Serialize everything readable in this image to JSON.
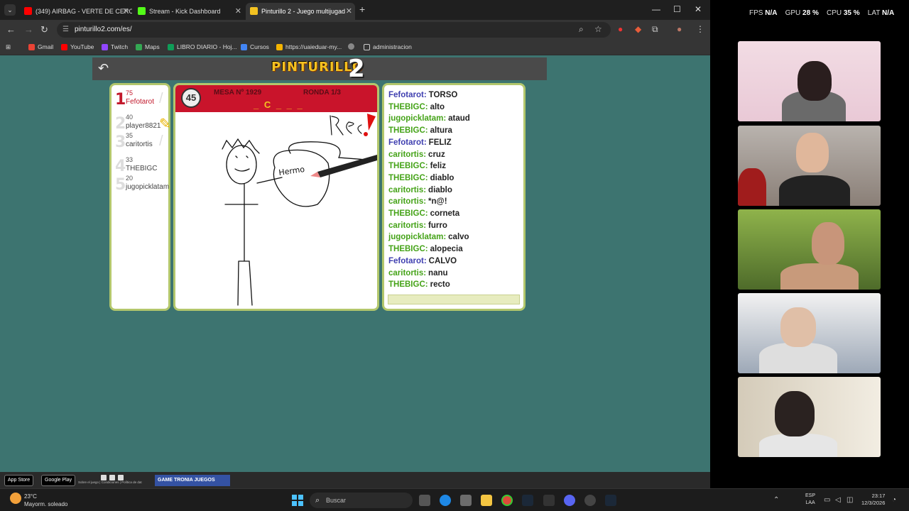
{
  "browser": {
    "tabs": [
      {
        "title": "(349) AIRBAG - VERTE DE CERC",
        "color": "#ff0000"
      },
      {
        "title": "Stream - Kick Dashboard",
        "color": "#53fc18"
      },
      {
        "title": "Pinturillo 2 - Juego multijugad",
        "color": "#f3c221"
      }
    ],
    "url": "pinturillo2.com/es/",
    "bookmarks": [
      {
        "label": "Gmail",
        "color": "#ea4335"
      },
      {
        "label": "YouTube",
        "color": "#ff0000"
      },
      {
        "label": "Twitch",
        "color": "#9146ff"
      },
      {
        "label": "Maps",
        "color": "#34a853"
      },
      {
        "label": "LIBRO DIARIO - Hoj...",
        "color": "#0f9d58"
      },
      {
        "label": "Cursos",
        "color": "#4285f4"
      },
      {
        "label": "https://uaieduar-my...",
        "color": "#f4b400"
      },
      {
        "label": "",
        "color": "#888888"
      },
      {
        "label": "administracion",
        "color": "#888888"
      }
    ]
  },
  "game": {
    "logo": "PINTURILLO",
    "logo_number": "2",
    "timer": "45",
    "mesa": "MESA Nº 1929",
    "ronda": "RONDA 1/3",
    "word": "_ C _ _ _",
    "players": [
      {
        "rank": "1",
        "points": "75",
        "name": "Fefotarot"
      },
      {
        "rank": "2",
        "points": "40",
        "name": "player8821"
      },
      {
        "rank": "3",
        "points": "35",
        "name": "caritortis"
      },
      {
        "rank": "4",
        "points": "33",
        "name": "THEBIGC"
      },
      {
        "rank": "5",
        "points": "20",
        "name": "jugopicklatam"
      }
    ],
    "drawing_text": {
      "rec": "Rec",
      "hermo": "Hermo"
    },
    "chat": [
      {
        "user": "Fefotarot:",
        "msg": "TORSO",
        "color": "#3f3fb0"
      },
      {
        "user": "THEBIGC:",
        "msg": "alto",
        "color": "#45a318"
      },
      {
        "user": "jugopicklatam:",
        "msg": "ataud",
        "color": "#45a318"
      },
      {
        "user": "THEBIGC:",
        "msg": "altura",
        "color": "#45a318"
      },
      {
        "user": "Fefotarot:",
        "msg": "FELIZ",
        "color": "#3f3fb0"
      },
      {
        "user": "caritortis:",
        "msg": "cruz",
        "color": "#45a318"
      },
      {
        "user": "THEBIGC:",
        "msg": "feliz",
        "color": "#45a318"
      },
      {
        "user": "THEBIGC:",
        "msg": "diablo",
        "color": "#45a318"
      },
      {
        "user": "caritortis:",
        "msg": "diablo",
        "color": "#45a318"
      },
      {
        "user": "caritortis:",
        "msg": "*n@!",
        "color": "#45a318"
      },
      {
        "user": "THEBIGC:",
        "msg": "corneta",
        "color": "#45a318"
      },
      {
        "user": "caritortis:",
        "msg": "furro",
        "color": "#45a318"
      },
      {
        "user": "jugopicklatam:",
        "msg": "calvo",
        "color": "#45a318"
      },
      {
        "user": "THEBIGC:",
        "msg": "alopecia",
        "color": "#45a318"
      },
      {
        "user": "Fefotarot:",
        "msg": "CALVO",
        "color": "#3f3fb0"
      },
      {
        "user": "caritortis:",
        "msg": "nanu",
        "color": "#45a318"
      },
      {
        "user": "THEBIGC:",
        "msg": "recto",
        "color": "#45a318"
      }
    ]
  },
  "footer": {
    "app_store": "App Store",
    "google_play": "Google Play",
    "links": "Sobre el juego | Condiciones | Política de dat",
    "promo": "GAME TRONIA  JUEGOS ONLINE"
  },
  "overlay": {
    "fps_label": "FPS",
    "fps": "N/A",
    "gpu_label": "GPU",
    "gpu": "28 %",
    "cpu_label": "CPU",
    "cpu": "35 %",
    "lat_label": "LAT",
    "lat": "N/A"
  },
  "taskbar": {
    "temp": "23°C",
    "weather": "Mayorm. soleado",
    "search_placeholder": "Buscar",
    "lang1": "ESP",
    "lang2": "LAA",
    "time": "23:17",
    "date": "12/3/2026"
  }
}
